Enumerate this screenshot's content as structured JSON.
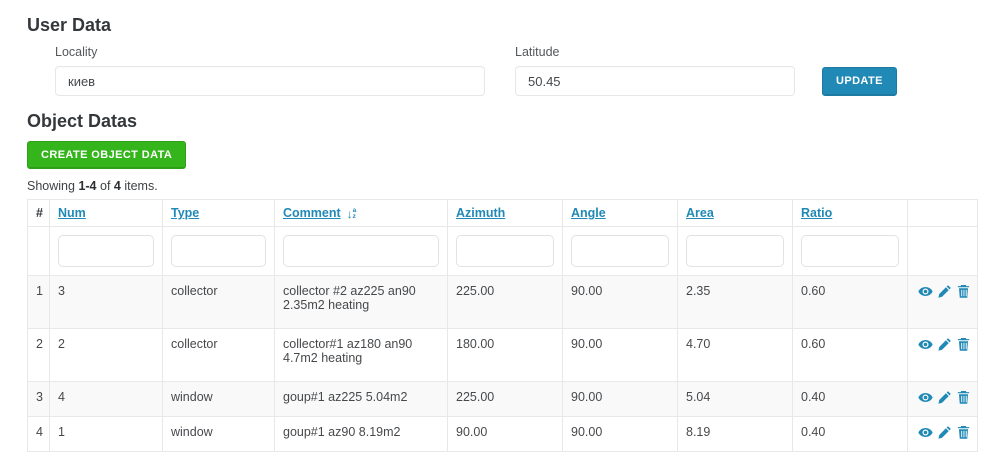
{
  "user_section": {
    "title": "User Data",
    "locality": {
      "label": "Locality",
      "value": "киев"
    },
    "latitude": {
      "label": "Latitude",
      "value": "50.45"
    },
    "update_button": "UPDATE"
  },
  "objects_section": {
    "title": "Object Datas",
    "create_button": "CREATE OBJECT DATA",
    "summary": {
      "showing": "Showing",
      "range": "1-4",
      "of": "of",
      "total": "4",
      "items": "items."
    },
    "table": {
      "headers": {
        "index": "#",
        "num": "Num",
        "type": "Type",
        "comment": "Comment",
        "azimuth": "Azimuth",
        "angle": "Angle",
        "area": "Area",
        "ratio": "Ratio"
      },
      "sort": {
        "column": "Comment",
        "icon": "sort-alphabet-icon",
        "letter_top": "a",
        "letter_bottom": "z"
      },
      "filters": {
        "num": "",
        "type": "",
        "comment": "",
        "azimuth": "",
        "angle": "",
        "area": "",
        "ratio": ""
      },
      "rows": [
        {
          "index": "1",
          "num": "3",
          "type": "collector",
          "comment": "collector #2 az225 an90 2.35m2 heating",
          "azimuth": "225.00",
          "angle": "90.00",
          "area": "2.35",
          "ratio": "0.60"
        },
        {
          "index": "2",
          "num": "2",
          "type": "collector",
          "comment": "collector#1 az180 an90 4.7m2 heating",
          "azimuth": "180.00",
          "angle": "90.00",
          "area": "4.70",
          "ratio": "0.60"
        },
        {
          "index": "3",
          "num": "4",
          "type": "window",
          "comment": "goup#1 az225 5.04m2",
          "azimuth": "225.00",
          "angle": "90.00",
          "area": "5.04",
          "ratio": "0.40"
        },
        {
          "index": "4",
          "num": "1",
          "type": "window",
          "comment": "goup#1 az90 8.19m2",
          "azimuth": "90.00",
          "angle": "90.00",
          "area": "8.19",
          "ratio": "0.40"
        }
      ],
      "row_icons": {
        "view": "eye-icon",
        "update": "pencil-icon",
        "delete": "trash-icon"
      }
    },
    "colors": {
      "link_blue": "#2089b5",
      "update_button_bg": "#2089b5",
      "create_button_bg": "#35b51c",
      "stripe_row": "#f9f9f9",
      "table_border": "#e8e8e8"
    }
  }
}
